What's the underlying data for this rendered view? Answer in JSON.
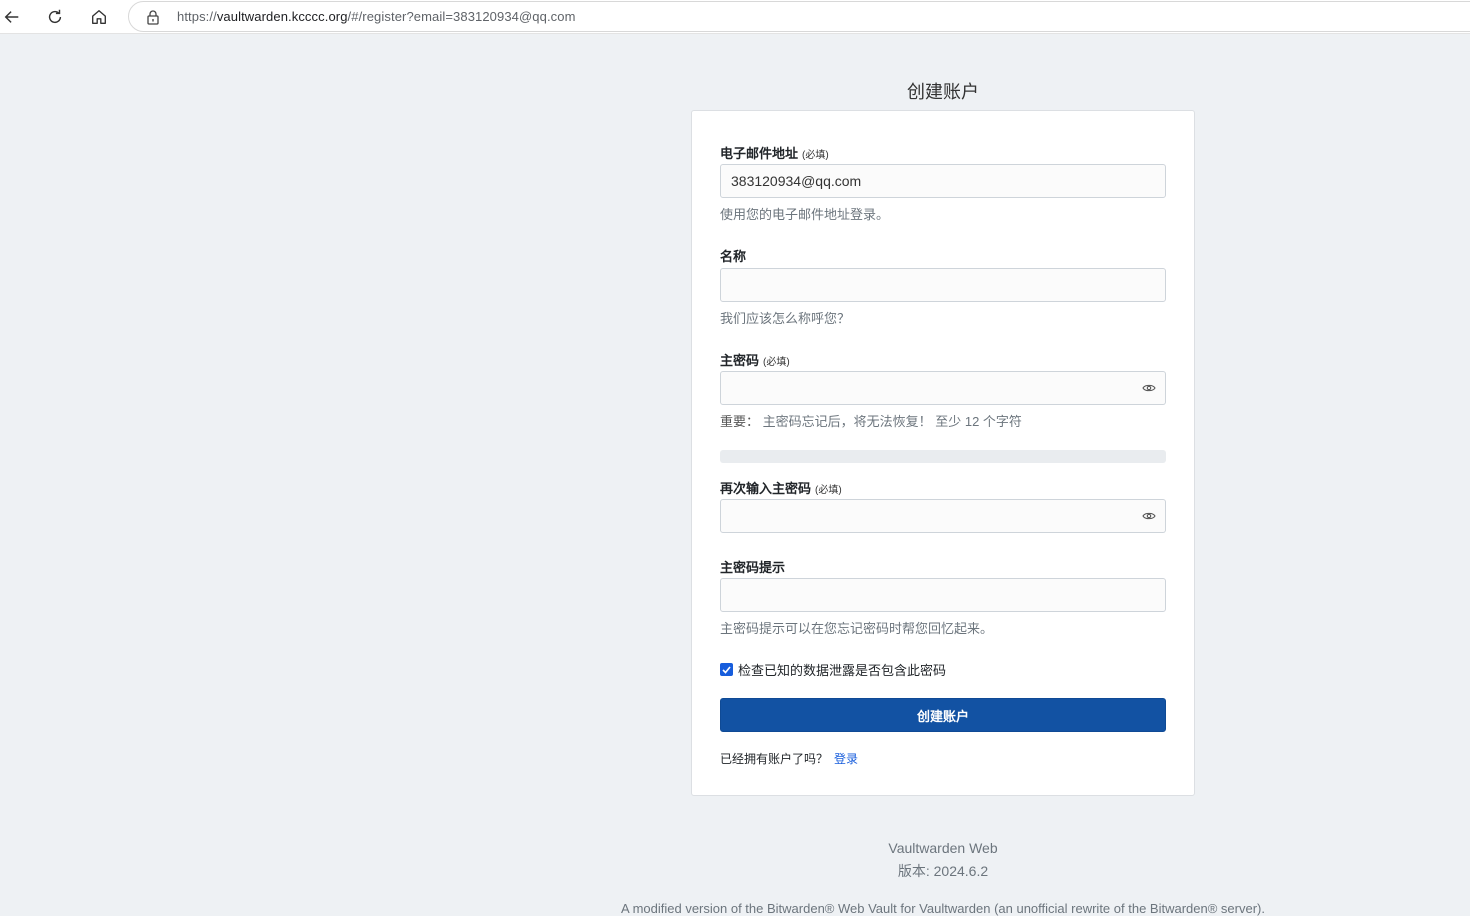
{
  "browser": {
    "url_prefix": "https://",
    "url_host": "vaultwarden.kcccc.org",
    "url_path": "/#/register?email=383120934@qq.com"
  },
  "page": {
    "title": "创建账户"
  },
  "form": {
    "email": {
      "label": "电子邮件地址",
      "required": "(必填)",
      "value": "383120934@qq.com",
      "help": "使用您的电子邮件地址登录。"
    },
    "name": {
      "label": "名称",
      "value": "",
      "help": "我们应该怎么称呼您？"
    },
    "master_password": {
      "label": "主密码",
      "required": "(必填)",
      "value": "",
      "help_important": "重要：",
      "help_text": "主密码忘记后，将无法恢复！ 至少 12 个字符"
    },
    "retype_password": {
      "label": "再次输入主密码",
      "required": "(必填)",
      "value": ""
    },
    "hint": {
      "label": "主密码提示",
      "value": "",
      "help": "主密码提示可以在您忘记密码时帮您回忆起来。"
    },
    "check_breach": {
      "label": "检查已知的数据泄露是否包含此密码",
      "checked": true
    },
    "submit_label": "创建账户",
    "already_have": "已经拥有账户了吗？",
    "login_link": "登录"
  },
  "footer": {
    "app_name": "Vaultwarden Web",
    "version": "版本: 2024.6.2",
    "note": "A modified version of the Bitwarden® Web Vault for Vaultwarden (an unofficial rewrite of the Bitwarden® server)."
  },
  "colors": {
    "background": "#eef1f4",
    "primary_button": "#1252a3",
    "link": "#175ddc"
  },
  "icons": [
    "back-arrow-icon",
    "reload-icon",
    "home-icon",
    "lock-icon",
    "eye-icon",
    "checkmark-icon"
  ]
}
